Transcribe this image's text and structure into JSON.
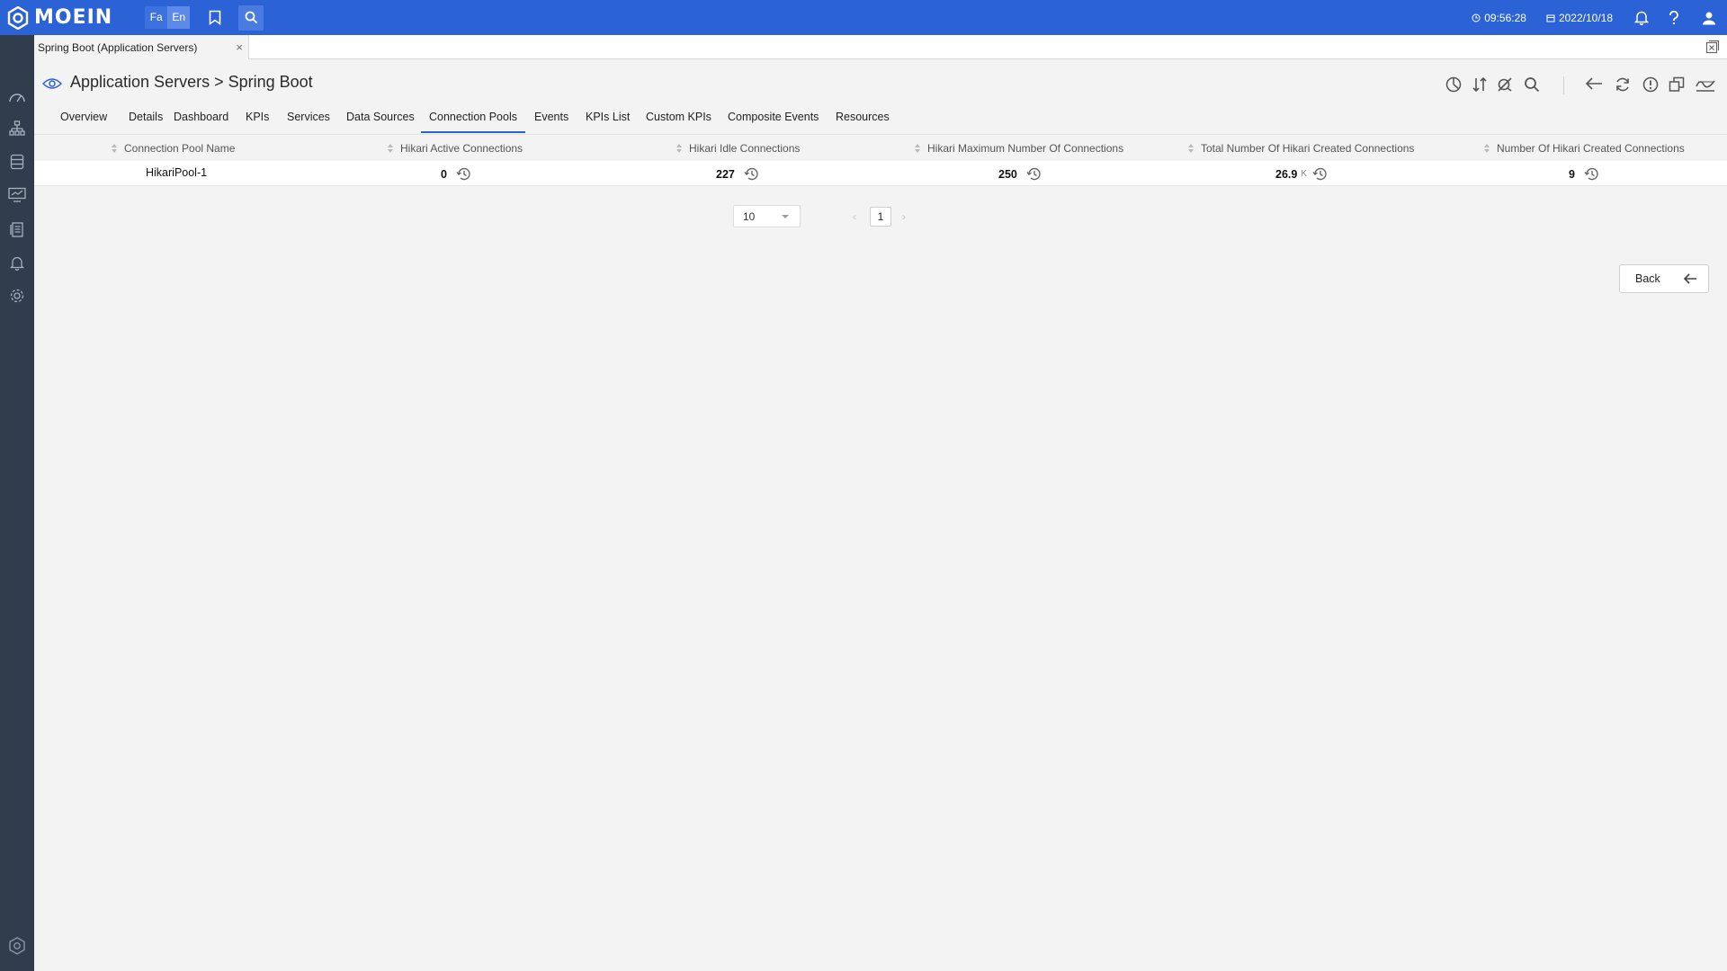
{
  "app": {
    "logo_text": "MOEIN",
    "lang_fa": "Fa",
    "lang_en": "En",
    "time": "09:56:28",
    "date": "2022/10/18"
  },
  "tabstrip": {
    "tab_label": "Spring Boot (Application Servers)",
    "close_glyph": "×"
  },
  "header": {
    "title": "Application Servers > Spring Boot"
  },
  "subtabs": [
    {
      "label": "Overview"
    },
    {
      "label": "Details"
    },
    {
      "label": "Dashboard"
    },
    {
      "label": "KPIs"
    },
    {
      "label": "Services"
    },
    {
      "label": "Data Sources"
    },
    {
      "label": "Connection Pools",
      "active": true
    },
    {
      "label": "Events"
    },
    {
      "label": "KPIs List"
    },
    {
      "label": "Custom KPIs"
    },
    {
      "label": "Composite Events"
    },
    {
      "label": "Resources"
    }
  ],
  "table": {
    "columns": [
      "Connection Pool Name",
      "Hikari Active Connections",
      "Hikari Idle Connections",
      "Hikari Maximum Number Of Connections",
      "Total Number Of Hikari Created Connections",
      "Number Of Hikari Created Connections"
    ],
    "rows": [
      {
        "name": "HikariPool-1",
        "active": "0",
        "idle": "227",
        "max": "250",
        "total": "26.9",
        "total_unit": "K",
        "created": "9"
      }
    ]
  },
  "pager": {
    "page_size": "10",
    "current_page": "1",
    "prev_glyph": "‹",
    "next_glyph": "›"
  },
  "back_button": {
    "label": "Back"
  },
  "colors": {
    "topbar": "#2b62d6",
    "sidebar": "#2f3d4d",
    "accent": "#2b62d6"
  },
  "icons": {
    "topbar": [
      "bookmark-icon",
      "search-icon",
      "clock-icon",
      "calendar-icon",
      "bell-icon",
      "help-icon",
      "user-icon"
    ],
    "sidebar": [
      "dashboard-icon",
      "topology-icon",
      "database-icon",
      "monitor-icon",
      "reports-icon",
      "alerts-icon",
      "settings-icon",
      "brand-icon"
    ],
    "toolbar": [
      "chart-icon",
      "sort-icon",
      "filter-off-icon",
      "search-icon",
      "back-arrow-icon",
      "refresh-icon",
      "info-icon",
      "copy-icon",
      "wave-icon"
    ]
  }
}
